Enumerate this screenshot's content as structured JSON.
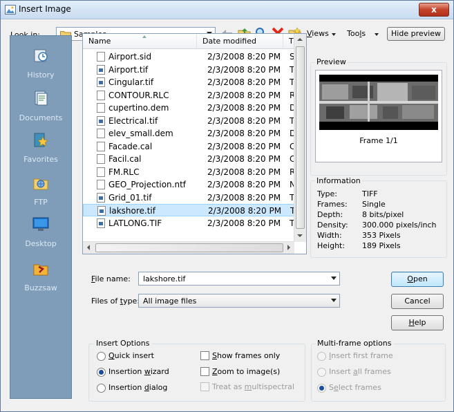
{
  "window": {
    "title": "Insert Image",
    "close": "x"
  },
  "lookin": {
    "label": "Look in:",
    "value": "Samples"
  },
  "toolbar": {
    "views": "Views",
    "tools": "Tools",
    "hide_preview": "Hide preview"
  },
  "sidebar": {
    "items": [
      {
        "label": "History",
        "icon": "history-icon"
      },
      {
        "label": "Documents",
        "icon": "documents-icon"
      },
      {
        "label": "Favorites",
        "icon": "favorites-icon"
      },
      {
        "label": "FTP",
        "icon": "ftp-icon"
      },
      {
        "label": "Desktop",
        "icon": "desktop-icon"
      },
      {
        "label": "Buzzsaw",
        "icon": "buzzsaw-icon"
      }
    ]
  },
  "filelist": {
    "columns": {
      "name": "Name",
      "date": "Date modified",
      "type": "T"
    },
    "rows": [
      {
        "name": "Airport.sid",
        "date": "2/3/2008 8:20 PM",
        "type": "S"
      },
      {
        "name": "Airport.tif",
        "date": "2/3/2008 8:20 PM",
        "type": "T"
      },
      {
        "name": "Cingular.tif",
        "date": "2/3/2008 8:20 PM",
        "type": "T"
      },
      {
        "name": "CONTOUR.RLC",
        "date": "2/3/2008 8:20 PM",
        "type": "R"
      },
      {
        "name": "cupertino.dem",
        "date": "2/3/2008 8:20 PM",
        "type": "D"
      },
      {
        "name": "Electrical.tif",
        "date": "2/3/2008 8:20 PM",
        "type": "T"
      },
      {
        "name": "elev_small.dem",
        "date": "2/3/2008 8:20 PM",
        "type": "D"
      },
      {
        "name": "Facade.cal",
        "date": "2/3/2008 8:20 PM",
        "type": "C"
      },
      {
        "name": "Facil.cal",
        "date": "2/3/2008 8:20 PM",
        "type": "C"
      },
      {
        "name": "FM.RLC",
        "date": "2/3/2008 8:20 PM",
        "type": "R"
      },
      {
        "name": "GEO_Projection.ntf",
        "date": "2/3/2008 8:20 PM",
        "type": "N"
      },
      {
        "name": "Grid_01.tif",
        "date": "2/3/2008 8:20 PM",
        "type": "T"
      },
      {
        "name": "lakshore.tif",
        "date": "2/3/2008 8:20 PM",
        "type": "T"
      },
      {
        "name": "LATLONG.TIF",
        "date": "2/3/2008 8:20 PM",
        "type": "T"
      }
    ]
  },
  "preview": {
    "title": "Preview",
    "frame": "Frame 1/1"
  },
  "information": {
    "title": "Information",
    "rows": [
      {
        "key": "Type:",
        "value": "TIFF"
      },
      {
        "key": "Frames:",
        "value": "Single"
      },
      {
        "key": "Depth:",
        "value": "8 bits/pixel"
      },
      {
        "key": "Density:",
        "value": "300.000 pixels/inch"
      },
      {
        "key": "Width:",
        "value": "353 Pixels"
      },
      {
        "key": "Height:",
        "value": "189 Pixels"
      }
    ]
  },
  "filename": {
    "label": "File name:",
    "value": "lakshore.tif"
  },
  "filetype": {
    "label": "Files of type:",
    "value": "All image files"
  },
  "buttons": {
    "open": "Open",
    "cancel": "Cancel",
    "help": "Help"
  },
  "insert_options": {
    "title": "Insert Options",
    "quick": "Quick insert",
    "wizard": "Insertion wizard",
    "dialog": "Insertion dialog",
    "show_frames": "Show frames only",
    "zoom": "Zoom to image(s)",
    "multispectral": "Treat as multispectral"
  },
  "multiframe": {
    "title": "Multi-frame options",
    "first": "Insert first frame",
    "all": "Insert all frames",
    "select": "Select frames"
  }
}
